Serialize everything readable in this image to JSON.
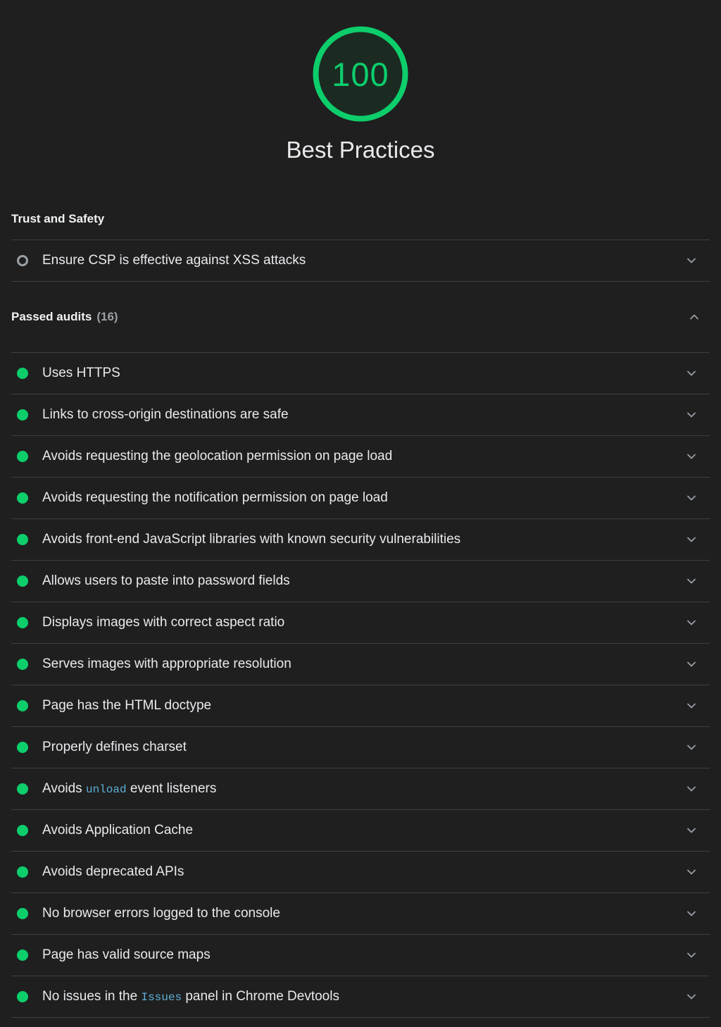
{
  "report": {
    "category": {
      "score": "100",
      "title": "Best Practices",
      "gauge_color": "#0cce6b",
      "gauge_bg_color": "#1c2b22"
    },
    "sections": {
      "trust_and_safety": {
        "title": "Trust and Safety",
        "audits": [
          {
            "title_prefix": "Ensure CSP is effective against XSS attacks",
            "code": "",
            "title_suffix": "",
            "status": "informative",
            "expand_icon": "chevron-down-icon"
          }
        ]
      },
      "passed_audits": {
        "label": "Passed audits",
        "count": "(16)",
        "collapse_icon": "chevron-up-icon",
        "expanded": true,
        "audits": [
          {
            "title_prefix": "Uses HTTPS",
            "code": "",
            "title_suffix": "",
            "status": "pass",
            "expand_icon": "chevron-down-icon"
          },
          {
            "title_prefix": "Links to cross-origin destinations are safe",
            "code": "",
            "title_suffix": "",
            "status": "pass",
            "expand_icon": "chevron-down-icon"
          },
          {
            "title_prefix": "Avoids requesting the geolocation permission on page load",
            "code": "",
            "title_suffix": "",
            "status": "pass",
            "expand_icon": "chevron-down-icon"
          },
          {
            "title_prefix": "Avoids requesting the notification permission on page load",
            "code": "",
            "title_suffix": "",
            "status": "pass",
            "expand_icon": "chevron-down-icon"
          },
          {
            "title_prefix": "Avoids front-end JavaScript libraries with known security vulnerabilities",
            "code": "",
            "title_suffix": "",
            "status": "pass",
            "expand_icon": "chevron-down-icon"
          },
          {
            "title_prefix": "Allows users to paste into password fields",
            "code": "",
            "title_suffix": "",
            "status": "pass",
            "expand_icon": "chevron-down-icon"
          },
          {
            "title_prefix": "Displays images with correct aspect ratio",
            "code": "",
            "title_suffix": "",
            "status": "pass",
            "expand_icon": "chevron-down-icon"
          },
          {
            "title_prefix": "Serves images with appropriate resolution",
            "code": "",
            "title_suffix": "",
            "status": "pass",
            "expand_icon": "chevron-down-icon"
          },
          {
            "title_prefix": "Page has the HTML doctype",
            "code": "",
            "title_suffix": "",
            "status": "pass",
            "expand_icon": "chevron-down-icon"
          },
          {
            "title_prefix": "Properly defines charset",
            "code": "",
            "title_suffix": "",
            "status": "pass",
            "expand_icon": "chevron-down-icon"
          },
          {
            "title_prefix": "Avoids ",
            "code": "unload",
            "title_suffix": " event listeners",
            "status": "pass",
            "expand_icon": "chevron-down-icon"
          },
          {
            "title_prefix": "Avoids Application Cache",
            "code": "",
            "title_suffix": "",
            "status": "pass",
            "expand_icon": "chevron-down-icon"
          },
          {
            "title_prefix": "Avoids deprecated APIs",
            "code": "",
            "title_suffix": "",
            "status": "pass",
            "expand_icon": "chevron-down-icon"
          },
          {
            "title_prefix": "No browser errors logged to the console",
            "code": "",
            "title_suffix": "",
            "status": "pass",
            "expand_icon": "chevron-down-icon"
          },
          {
            "title_prefix": "Page has valid source maps",
            "code": "",
            "title_suffix": "",
            "status": "pass",
            "expand_icon": "chevron-down-icon"
          },
          {
            "title_prefix": "No issues in the ",
            "code": "Issues",
            "title_suffix": " panel in Chrome Devtools",
            "status": "pass",
            "expand_icon": "chevron-down-icon"
          }
        ]
      }
    }
  }
}
